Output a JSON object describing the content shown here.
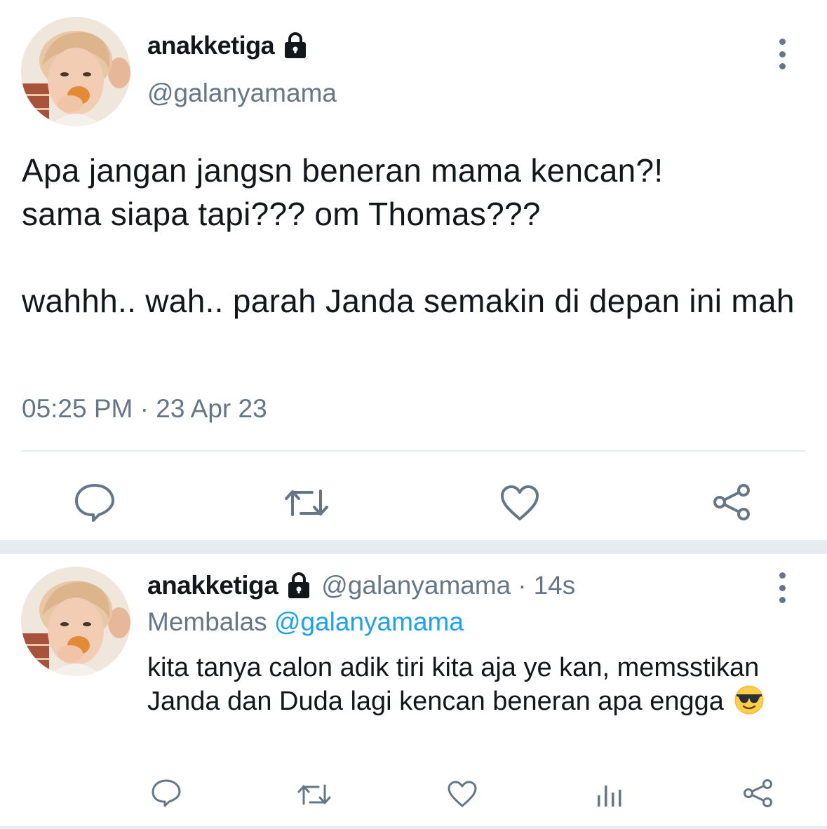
{
  "main_tweet": {
    "author_name": "anakketiga",
    "author_handle": "@galanyamama",
    "text": "Apa jangan jangsn beneran mama kencan?!\nsama siapa tapi??? om Thomas???\n\nwahhh.. wah.. parah Janda semakin di depan ini mah",
    "timestamp": "05:25 PM · 23 Apr 23",
    "actions": [
      "reply-icon",
      "retweet-icon",
      "like-icon",
      "share-icon"
    ]
  },
  "reply_tweet": {
    "author_name": "anakketiga",
    "author_handle": "@galanyamama",
    "separator": "·",
    "time_ago": "14s",
    "replying_label": "Membalas",
    "replying_to": "@galanyamama",
    "text": "kita tanya calon adik tiri kita aja ye kan, memsstikan Janda dan Duda lagi kencan beneran apa engga",
    "emoji": "smiling-face-with-sunglasses",
    "actions": [
      "reply-icon",
      "retweet-icon",
      "like-icon",
      "analytics-icon",
      "share-icon"
    ]
  },
  "colors": {
    "text_primary": "#14171a",
    "text_secondary": "#657786",
    "link": "#1da1f2",
    "divider": "#e6ecf0"
  }
}
